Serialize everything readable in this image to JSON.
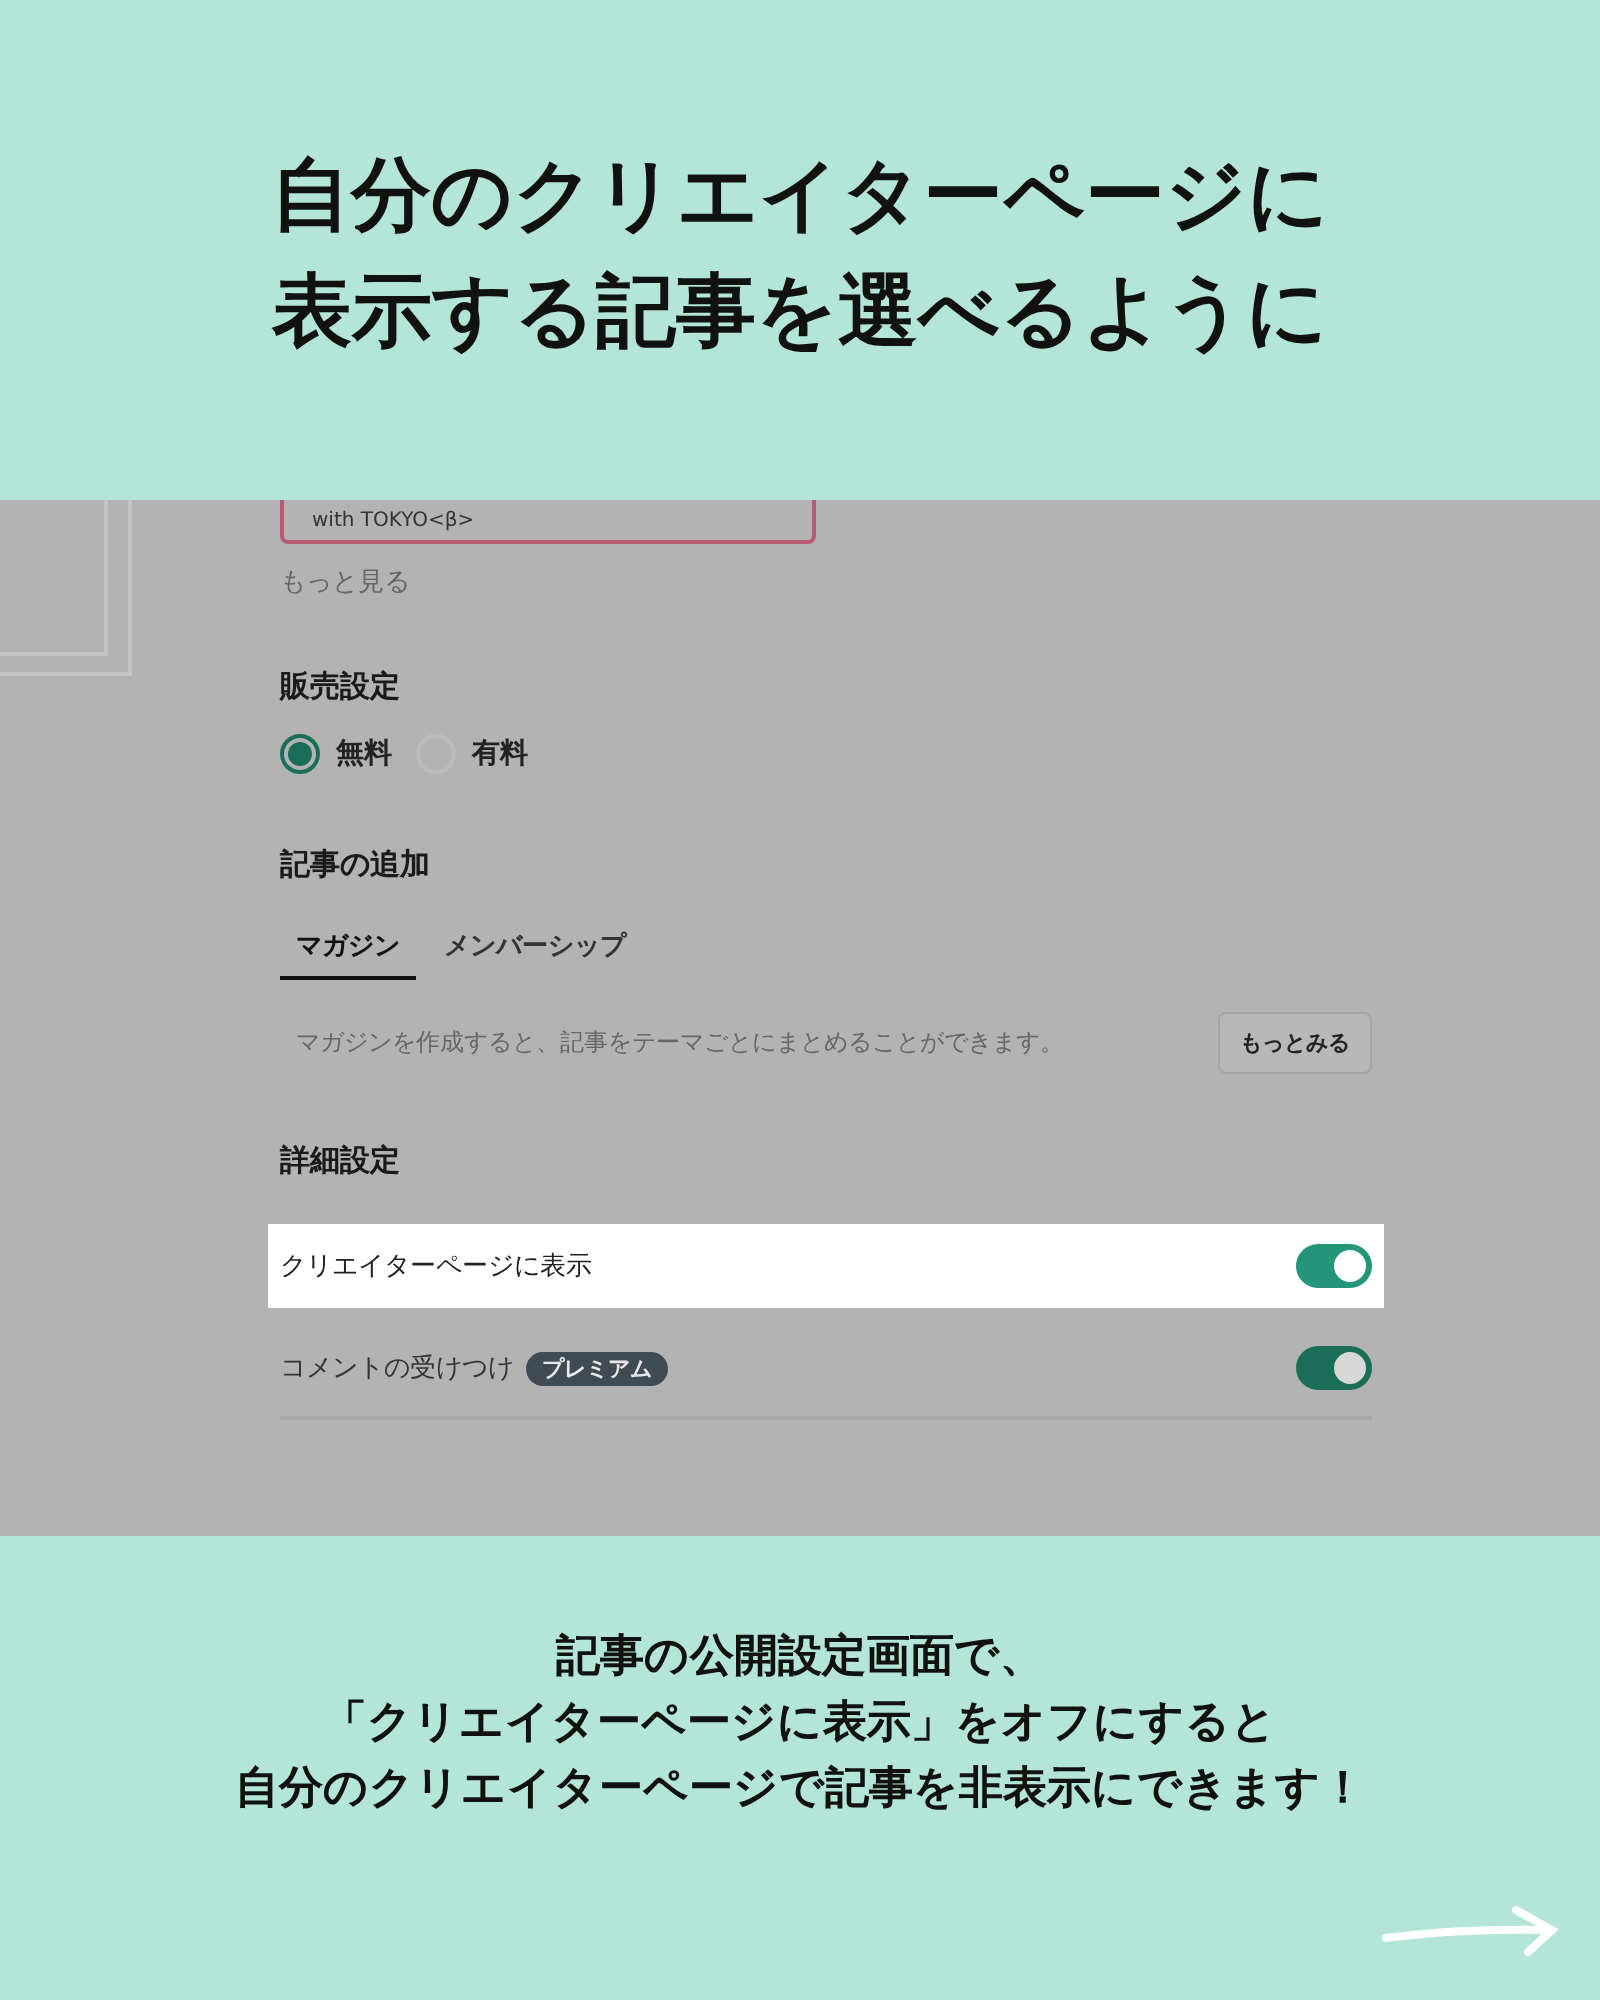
{
  "header": {
    "lines": [
      "自分のクリエイターページに",
      "表示する記事を選べるように"
    ]
  },
  "screen": {
    "article_card": {
      "text": "with TOKYO<β>"
    },
    "more_link": "もっと見る",
    "sales": {
      "title": "販売設定",
      "options": [
        {
          "label": "無料",
          "selected": true
        },
        {
          "label": "有料",
          "selected": false
        }
      ]
    },
    "add_article": {
      "title": "記事の追加",
      "tabs": [
        {
          "label": "マガジン",
          "selected": true
        },
        {
          "label": "メンバーシップ",
          "selected": false
        }
      ],
      "description": "マガジンを作成すると、記事をテーマごとにまとめることができます。",
      "button": "もっとみる"
    },
    "details": {
      "title": "詳細設定",
      "settings": [
        {
          "label": "クリエイターページに表示",
          "on": true,
          "highlighted": true
        },
        {
          "label": "コメントの受けつけ",
          "badge": "プレミアム",
          "on": true,
          "highlighted": false
        }
      ]
    }
  },
  "caption": {
    "lines": [
      "記事の公開設定画面で、",
      "「クリエイターページに表示」をオフにすると",
      "自分のクリエイターページで記事を非表示にできます！"
    ]
  }
}
